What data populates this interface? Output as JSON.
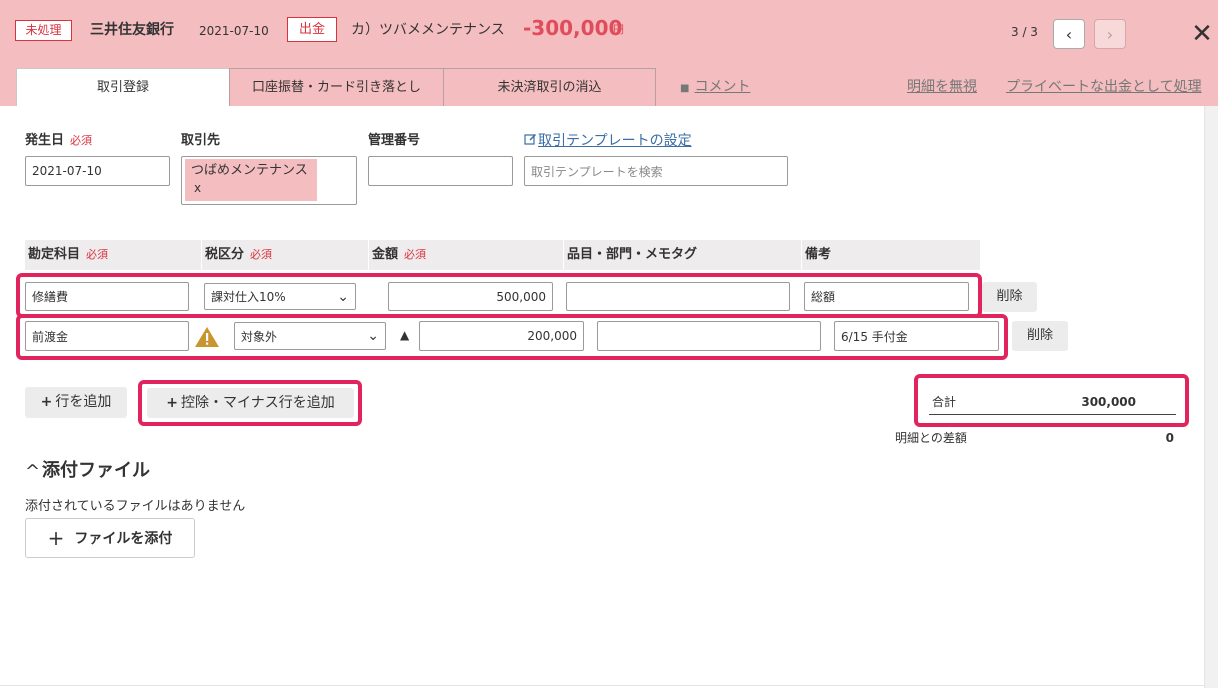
{
  "header": {
    "status": "未処理",
    "bank": "三井住友銀行",
    "date": "2021-07-10",
    "type": "出金",
    "partner": "カ）ツバメメンテナンス",
    "amount": "-300,000",
    "amount_unit": "円",
    "page_count": "3 / 3",
    "prev_icon": "‹",
    "next_icon": "›",
    "close_icon": "✕"
  },
  "tabs": [
    "取引登録",
    "口座振替・カード引き落とし",
    "未決済取引の消込"
  ],
  "links": {
    "comment": "コメント",
    "comment_icon": "■",
    "ignore": "明細を無視",
    "private": "プライベートな出金として処理"
  },
  "form": {
    "date_label": "発生日",
    "required": "必須",
    "date_value": "2021-07-10",
    "partner_label": "取引先",
    "partner_tag": "つばめメンテナンス",
    "partner_remove": "x",
    "mgmt_label": "管理番号",
    "template_link": "取引テンプレートの設定",
    "template_placeholder": "取引テンプレートを検索"
  },
  "table": {
    "headers": {
      "account": "勘定科目",
      "tax": "税区分",
      "amount": "金額",
      "item": "品目・部門・メモタグ",
      "note": "備考"
    },
    "rows": [
      {
        "account": "修繕費",
        "tax": "課対仕入10%",
        "amount": "500,000",
        "item": "",
        "note": "総額",
        "delete": "削除"
      },
      {
        "account": "前渡金",
        "tax": "対象外",
        "minus_mark": "▲",
        "amount": "200,000",
        "item": "",
        "note": "6/15 手付金",
        "delete": "削除"
      }
    ],
    "dropdown_icon": "⌄"
  },
  "actions": {
    "add_row": "行を追加",
    "add_minus_row": "控除・マイナス行を追加",
    "plus_icon": "+"
  },
  "totals": {
    "total_label": "合計",
    "total_value": "300,000",
    "diff_label": "明細との差額",
    "diff_value": "0"
  },
  "attachments": {
    "title": "添付ファイル",
    "chevron": "^",
    "empty": "添付されているファイルはありません",
    "add_button": "ファイルを添付"
  },
  "colors": {
    "header_bg": "#f4bdbf",
    "accent_red": "#d9333f",
    "highlight": "#e1245e",
    "warning": "#c8952f"
  }
}
